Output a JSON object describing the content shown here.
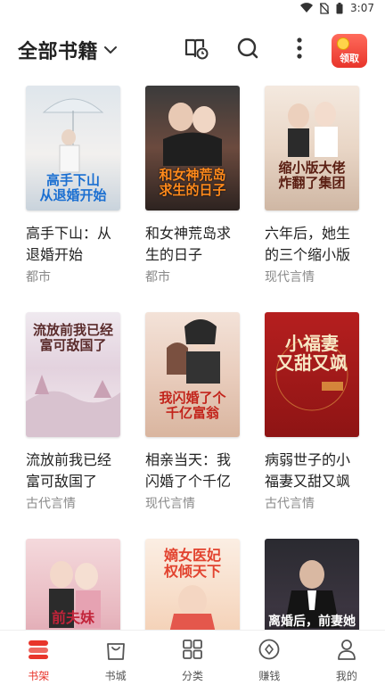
{
  "status": {
    "time": "3:07"
  },
  "header": {
    "title": "全部书籍",
    "claim_label": "领取"
  },
  "colors": {
    "accent": "#e8352b",
    "genre_text": "#8a8a8a"
  },
  "books": [
    {
      "title": "高手下山：从退婚开始",
      "genre": "都市",
      "cover_text": "高手下山\n从退婚开始"
    },
    {
      "title": "和女神荒岛求生的日子",
      "genre": "都市",
      "cover_text": "和女神荒岛\n求生的日子"
    },
    {
      "title": "六年后，她生的三个缩小版",
      "genre": "现代言情",
      "cover_text": "缩小版大佬\n炸翻了集团"
    },
    {
      "title": "流放前我已经富可敌国了",
      "genre": "古代言情",
      "cover_text": "流放前我已经\n富可敌国了"
    },
    {
      "title": "相亲当天：我闪婚了个千亿",
      "genre": "现代言情",
      "cover_text": "我闪婚了个\n千亿富翁"
    },
    {
      "title": "病弱世子的小福妻又甜又飒",
      "genre": "古代言情",
      "cover_text": "小福妻\n又甜又飒"
    },
    {
      "title": "",
      "genre": "",
      "cover_text": "前夫妹"
    },
    {
      "title": "",
      "genre": "",
      "cover_text": "嫡女医妃\n权倾天下"
    },
    {
      "title": "",
      "genre": "",
      "cover_text": "离婚后，前妻她"
    }
  ],
  "tabs": [
    {
      "label": "书架",
      "icon": "bookshelf-icon",
      "active": true
    },
    {
      "label": "书城",
      "icon": "store-icon",
      "active": false
    },
    {
      "label": "分类",
      "icon": "category-grid-icon",
      "active": false
    },
    {
      "label": "赚钱",
      "icon": "earn-coin-icon",
      "active": false
    },
    {
      "label": "我的",
      "icon": "profile-icon",
      "active": false
    }
  ]
}
